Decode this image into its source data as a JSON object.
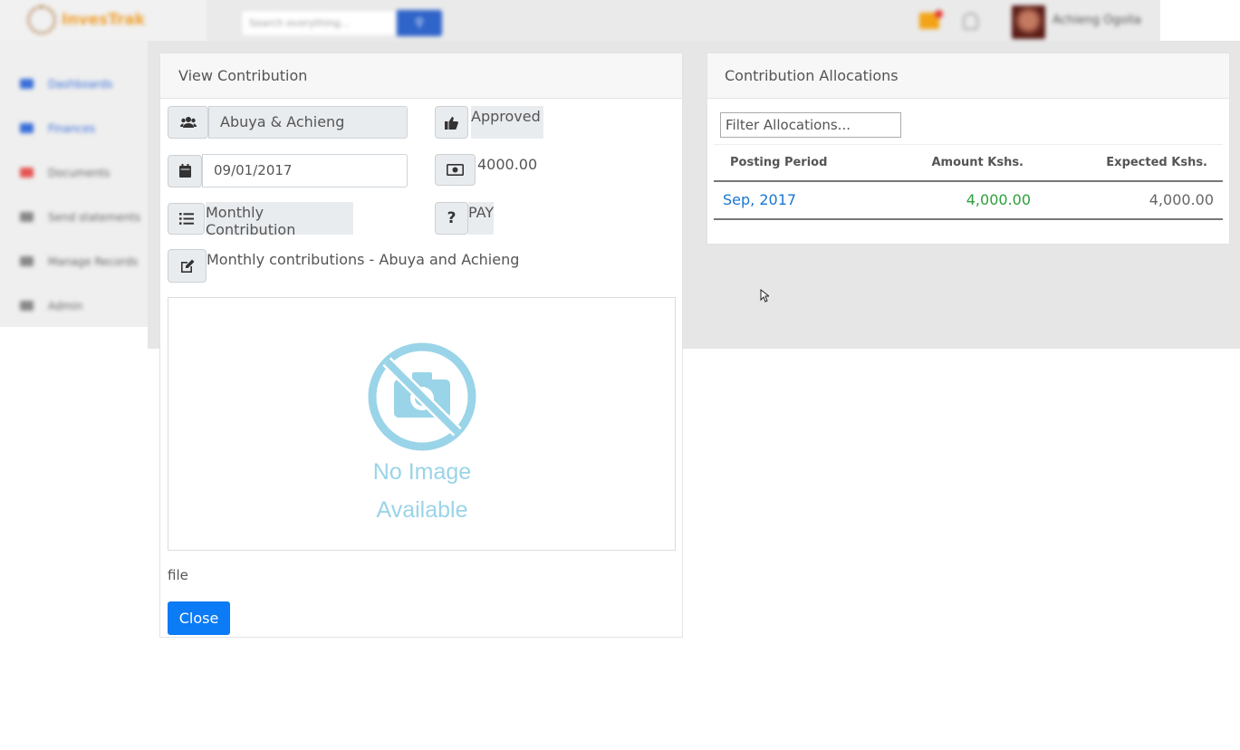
{
  "header": {
    "logo_text": "InvesTrak",
    "search_placeholder": "Search everything...",
    "user_name": "Achieng Ogolla",
    "colors": {
      "search_button": "#2f64c9",
      "mail_badge": "#f3a317",
      "notification_dot": "#e53935"
    }
  },
  "sidebar": {
    "items": [
      {
        "label": "Dashboards",
        "icon": "cloud-icon"
      },
      {
        "label": "Finances",
        "icon": "wallet-icon"
      },
      {
        "label": "Documents",
        "icon": "document-icon"
      },
      {
        "label": "Send statements",
        "icon": "send-icon"
      },
      {
        "label": "Manage Records",
        "icon": "folder-icon"
      },
      {
        "label": "Admin",
        "icon": "admin-icon"
      }
    ]
  },
  "view": {
    "title": "View Contribution",
    "member": "Abuya & Achieng",
    "status": "Approved",
    "date": "09/01/2017",
    "amount": "4000.00",
    "type": "Monthly Contribution",
    "method": "PAY",
    "description": "Monthly contributions - Abuya and Achieng",
    "image_placeholder": {
      "line1": "No Image",
      "line2": "Available"
    },
    "file_label": "file",
    "close_label": "Close"
  },
  "allocations": {
    "title": "Contribution Allocations",
    "filter_placeholder": "Filter Allocations...",
    "columns": [
      "Posting Period",
      "Amount Kshs.",
      "Expected Kshs."
    ],
    "rows": [
      {
        "period": "Sep, 2017",
        "amount": "4,000.00",
        "expected": "4,000.00"
      }
    ],
    "colors": {
      "link": "#1976d2",
      "amount": "#2ea03a"
    }
  }
}
